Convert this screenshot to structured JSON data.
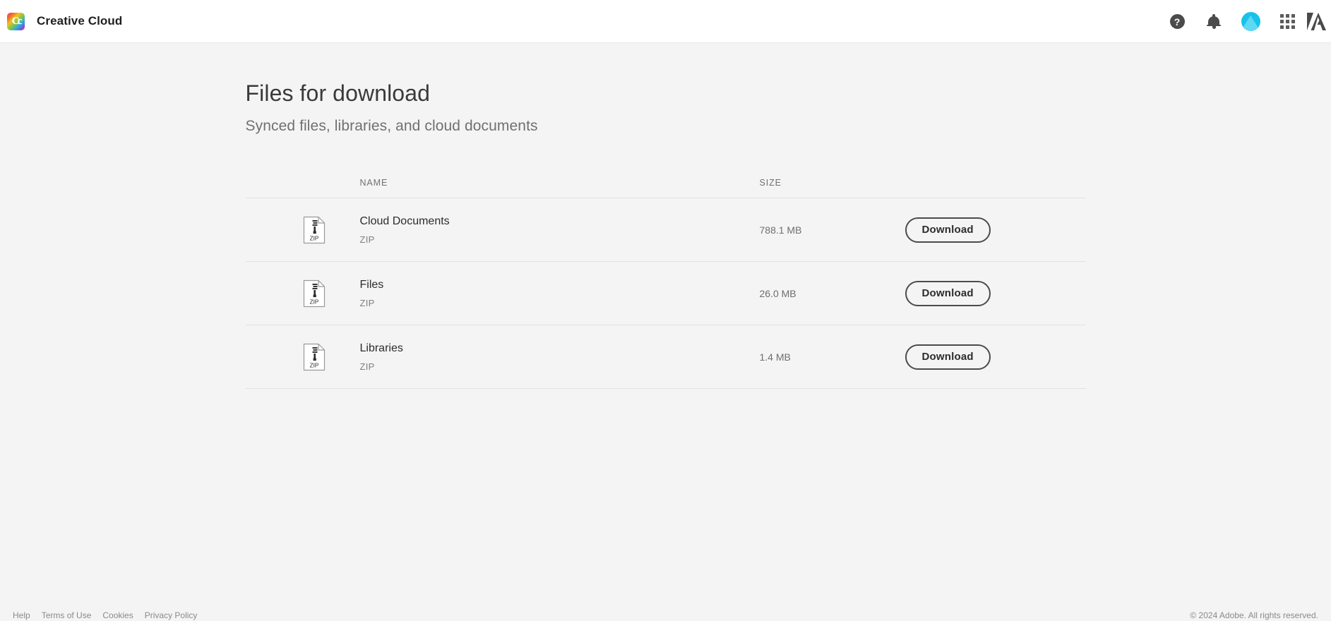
{
  "topbar": {
    "brand_icon": "creative-cloud-logo",
    "brand_glyph": "Cc",
    "title": "Creative Cloud",
    "icons": [
      {
        "name": "help-icon",
        "glyph": "?"
      },
      {
        "name": "notifications-bell-icon",
        "glyph": "bell"
      },
      {
        "name": "user-avatar",
        "glyph": "avatar"
      },
      {
        "name": "app-switcher-grid-icon",
        "glyph": "grid"
      },
      {
        "name": "adobe-logo-icon",
        "glyph": "A"
      }
    ],
    "accent_avatar_color": "#18c2ea",
    "background": "#ffffff"
  },
  "page": {
    "title": "Files for download",
    "subtitle": "Synced files, libraries, and cloud documents"
  },
  "table": {
    "columns": {
      "name": "NAME",
      "size": "SIZE"
    },
    "rows": [
      {
        "icon": "zip-file-icon",
        "icon_label": "ZIP",
        "name": "Cloud Documents",
        "type": "ZIP",
        "size": "788.1 MB",
        "action_label": "Download"
      },
      {
        "icon": "zip-file-icon",
        "icon_label": "ZIP",
        "name": "Files",
        "type": "ZIP",
        "size": "26.0 MB",
        "action_label": "Download"
      },
      {
        "icon": "zip-file-icon",
        "icon_label": "ZIP",
        "name": "Libraries",
        "type": "ZIP",
        "size": "1.4 MB",
        "action_label": "Download"
      }
    ]
  },
  "footer": {
    "links": [
      "Help",
      "Terms of Use",
      "Cookies",
      "Privacy Policy"
    ],
    "copyright": "© 2024 Adobe. All rights reserved."
  },
  "colors": {
    "page_background": "#f4f4f4",
    "divider": "#e2e2e2",
    "text_primary": "#2c2c2c",
    "text_secondary": "#707070"
  }
}
